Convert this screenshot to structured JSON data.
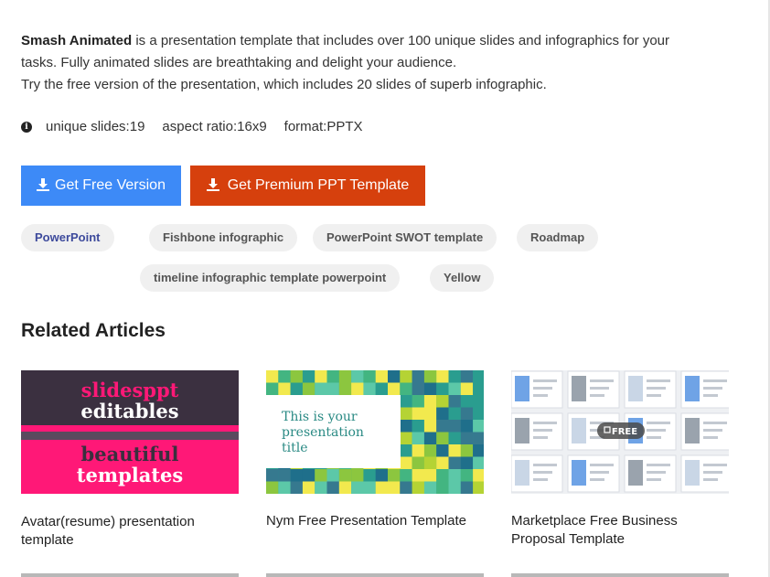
{
  "description": {
    "bold_name": "Smash Animated",
    "line1_rest": " is a presentation template that includes over 100 unique slides and infographics for your",
    "line2": "tasks. Fully animated slides are breathtaking and delight your audience.",
    "line3": "Try the free version of the presentation, which includes 20 slides of superb infographic."
  },
  "meta": {
    "info_glyph": "i",
    "unique_slides": "unique slides:19",
    "aspect_ratio": "aspect ratio:16x9",
    "format": "format:PPTX"
  },
  "buttons": {
    "free_label": "Get Free Version",
    "premium_label": "Get Premium PPT Template",
    "free_color": "#3d8af7",
    "premium_color": "#d6400d"
  },
  "tags": [
    "PowerPoint",
    "Fishbone infographic",
    "PowerPoint SWOT template",
    "Roadmap",
    "timeline infographic template powerpoint",
    "Yellow"
  ],
  "related": {
    "title": "Related Articles",
    "cards": [
      {
        "title_line1": "Avatar(resume) presentation",
        "title_line2": "template",
        "thumb_text": [
          "slidesppt",
          "editables",
          "beautiful",
          "templates"
        ]
      },
      {
        "title_line1": "Nym Free Presentation Template",
        "title_line2": "",
        "thumb_text": [
          "This is your",
          "presentation",
          "title"
        ]
      },
      {
        "title_line1": "Marketplace Free Business",
        "title_line2": "Proposal Template",
        "thumb_text": [
          "FREE"
        ]
      }
    ]
  }
}
